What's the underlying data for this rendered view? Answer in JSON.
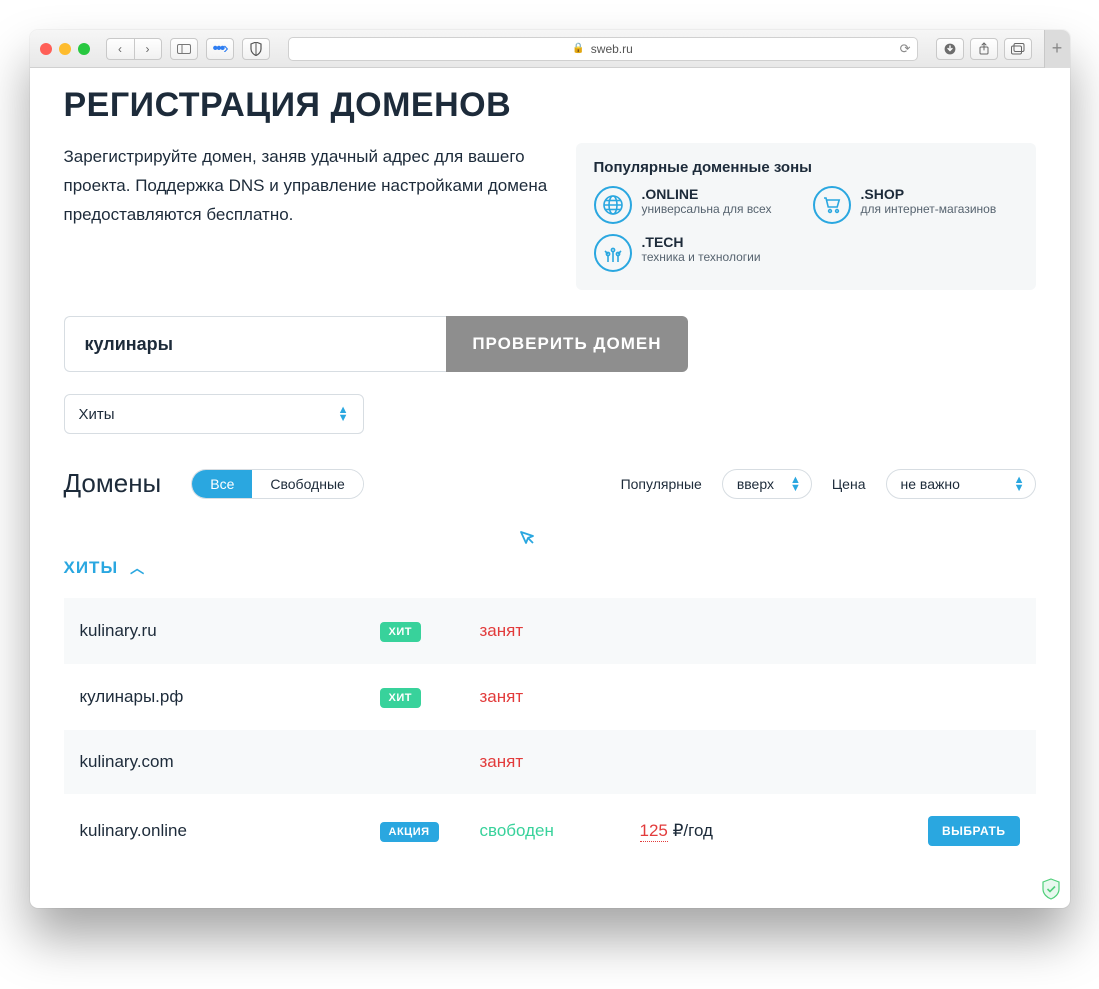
{
  "browser": {
    "url_host": "sweb.ru"
  },
  "header": {
    "title": "РЕГИСТРАЦИЯ ДОМЕНОВ",
    "intro": "Зарегистрируйте домен, заняв удачный адрес для вашего проекта. Поддержка DNS и управление настройками домена предоставляются бесплатно."
  },
  "popular": {
    "title": "Популярные доменные зоны",
    "zones": [
      {
        "name": ".ONLINE",
        "desc": "универсальна для всех"
      },
      {
        "name": ".SHOP",
        "desc": "для интернет-магазинов"
      },
      {
        "name": ".TECH",
        "desc": "техника и технологии"
      }
    ]
  },
  "search": {
    "value": "кулинары",
    "button": "ПРОВЕРИТЬ ДОМЕН"
  },
  "category_select": "Хиты",
  "section_title": "Домены",
  "filters": {
    "tabs": {
      "all": "Все",
      "free": "Свободные"
    },
    "popularity_label": "Популярные",
    "popularity_value": "вверх",
    "price_label": "Цена",
    "price_value": "не важно"
  },
  "group": {
    "title": "ХИТЫ"
  },
  "badges": {
    "hit": "ХИТ",
    "promo": "АКЦИЯ"
  },
  "status_text": {
    "taken": "занят",
    "free": "свободен"
  },
  "price_suffix": "₽/год",
  "choose_label": "ВЫБРАТЬ",
  "rows": [
    {
      "domain": "kulinary.ru",
      "badge": "hit",
      "status": "taken"
    },
    {
      "domain": "кулинары.рф",
      "badge": "hit",
      "status": "taken"
    },
    {
      "domain": "kulinary.com",
      "badge": null,
      "status": "taken"
    },
    {
      "domain": "kulinary.online",
      "badge": "promo",
      "status": "free",
      "price": "125"
    }
  ]
}
